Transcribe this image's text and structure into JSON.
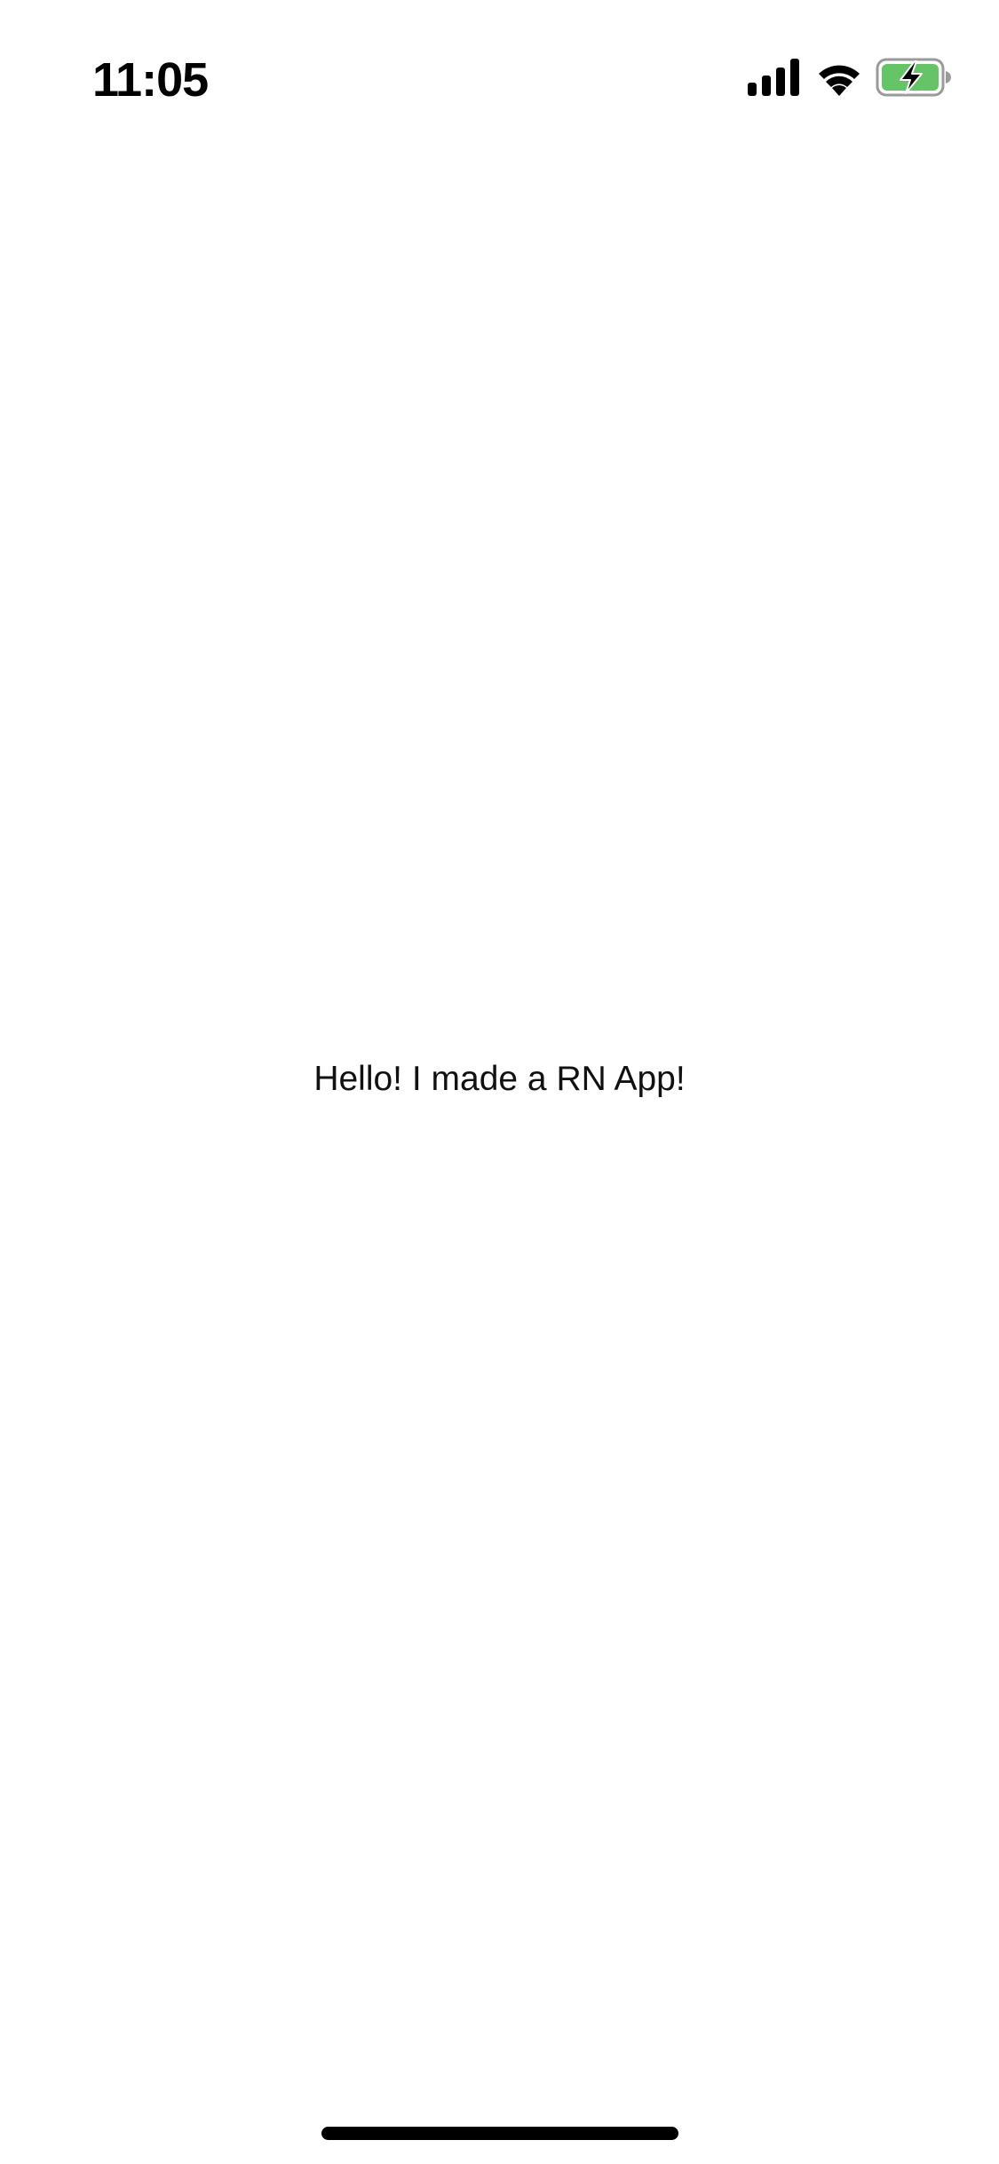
{
  "status_bar": {
    "time": "11:05",
    "icons": [
      "signal-icon",
      "wifi-icon",
      "battery-charging-icon"
    ],
    "battery_color": "#65C466"
  },
  "main": {
    "message": "Hello! I made a RN App!"
  }
}
